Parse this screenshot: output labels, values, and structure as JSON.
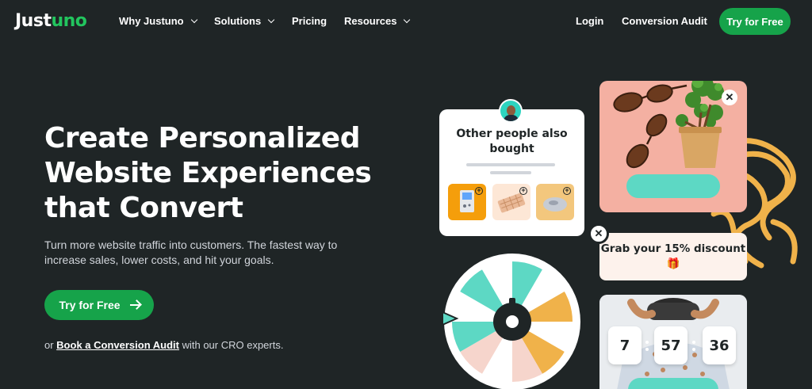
{
  "nav": {
    "logo_part1": "Just",
    "logo_part2": "uno",
    "items": [
      {
        "label": "Why Justuno",
        "has_dropdown": true
      },
      {
        "label": "Solutions",
        "has_dropdown": true
      },
      {
        "label": "Pricing",
        "has_dropdown": false
      },
      {
        "label": "Resources",
        "has_dropdown": true
      }
    ],
    "login": "Login",
    "audit": "Conversion Audit",
    "cta": "Try for Free"
  },
  "hero": {
    "title": "Create Personalized Website Experiences that Convert",
    "subtitle": "Turn more website traffic into customers. The fastest way to increase sales, lower costs, and hit your goals.",
    "cta": "Try for Free",
    "audit_prefix": "or ",
    "audit_link": "Book a Conversion Audit",
    "audit_suffix": " with our CRO experts."
  },
  "recommendation_card": {
    "title": "Other people also bought"
  },
  "discount_card": {
    "text": "Grab your 15% discount 🎁"
  },
  "countdown": {
    "values": [
      "7",
      "57",
      "36"
    ]
  },
  "colors": {
    "background": "#1f2526",
    "brand_green": "#16a34a",
    "logo_green": "#22c55e",
    "teal": "#5dd8c4",
    "peach": "#f4b0a2",
    "yellow": "#f0b24a"
  }
}
